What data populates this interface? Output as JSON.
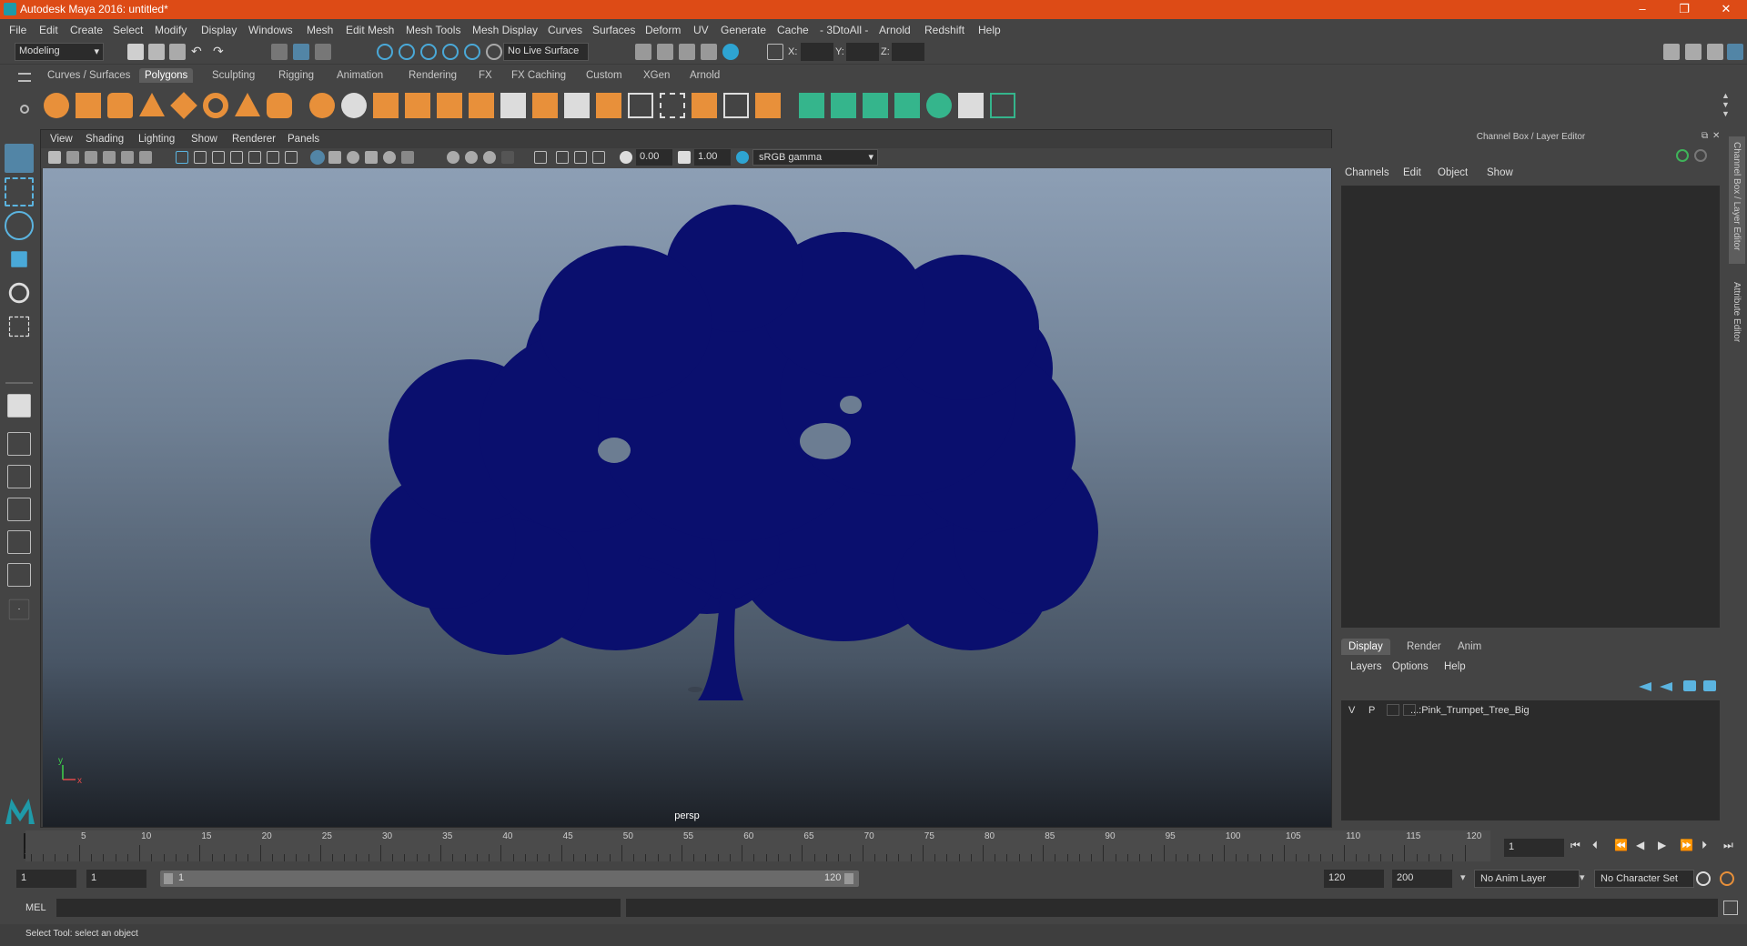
{
  "window": {
    "title": "Autodesk Maya 2016: untitled*",
    "min": "–",
    "max": "❐",
    "close": "✕"
  },
  "menubar": [
    "File",
    "Edit",
    "Create",
    "Select",
    "Modify",
    "Display",
    "Windows",
    "Mesh",
    "Edit Mesh",
    "Mesh Tools",
    "Mesh Display",
    "Curves",
    "Surfaces",
    "Deform",
    "UV",
    "Generate",
    "Cache",
    "- 3DtoAll -",
    "Arnold",
    "Redshift",
    "Help"
  ],
  "statusline": {
    "mode": "Modeling",
    "live_surface": "No Live Surface",
    "x_label": "X:",
    "y_label": "Y:",
    "z_label": "Z:"
  },
  "shelf_tabs": [
    "Curves / Surfaces",
    "Polygons",
    "Sculpting",
    "Rigging",
    "Animation",
    "Rendering",
    "FX",
    "FX Caching",
    "Custom",
    "XGen",
    "Arnold"
  ],
  "shelf_active": "Polygons",
  "viewport": {
    "menu": [
      "View",
      "Shading",
      "Lighting",
      "Show",
      "Renderer",
      "Panels"
    ],
    "exposure": "0.00",
    "gamma": "1.00",
    "colorspace": "sRGB gamma",
    "camera_label": "persp",
    "axis_y": "y",
    "axis_x": "x"
  },
  "channel_box": {
    "title": "Channel Box / Layer Editor",
    "menu": [
      "Channels",
      "Edit",
      "Object",
      "Show"
    ]
  },
  "layer_editor": {
    "tabs": [
      "Display",
      "Render",
      "Anim"
    ],
    "active_tab": "Display",
    "menu": [
      "Layers",
      "Options",
      "Help"
    ],
    "layers": [
      {
        "v": "V",
        "p": "P",
        "name": "...:Pink_Trumpet_Tree_Big"
      }
    ]
  },
  "side_tabs": [
    "Channel Box / Layer Editor",
    "Attribute Editor"
  ],
  "timeline": {
    "ticks": [
      "5",
      "10",
      "15",
      "20",
      "25",
      "30",
      "35",
      "40",
      "45",
      "50",
      "55",
      "60",
      "65",
      "70",
      "75",
      "80",
      "85",
      "90",
      "95",
      "100",
      "105",
      "110",
      "115",
      "120"
    ],
    "start_marker": "1",
    "current_frame": "1"
  },
  "range": {
    "start": "1",
    "anim_start": "1",
    "slider_start": "1",
    "slider_end": "120",
    "anim_end": "120",
    "end": "200",
    "anim_layer": "No Anim Layer",
    "character_set": "No Character Set"
  },
  "cmdline": {
    "label": "MEL"
  },
  "helpline": {
    "text": "Select Tool: select an object"
  },
  "colors": {
    "titlebar": "#dd4b16",
    "tree": "#0a0f6e",
    "accent": "#5285a6"
  }
}
